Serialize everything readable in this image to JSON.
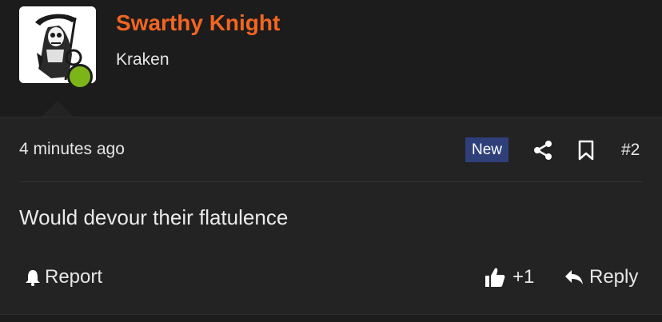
{
  "user": {
    "name": "Swarthy Knight",
    "title": "Kraken",
    "avatar_icon": "grim-reaper-avatar",
    "online_color": "#7cb518",
    "name_color": "#f26522"
  },
  "post": {
    "timestamp": "4 minutes ago",
    "badge": "New",
    "number": "#2",
    "message": "Would devour their flatulence"
  },
  "actions": {
    "report_label": "Report",
    "like_count": "+1",
    "reply_label": "Reply"
  },
  "icons": [
    "share-icon",
    "bookmark-icon",
    "bell-icon",
    "thumbs-up-icon",
    "reply-icon"
  ]
}
